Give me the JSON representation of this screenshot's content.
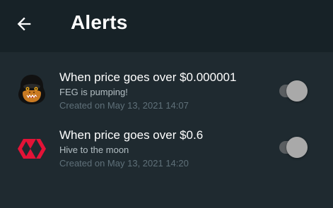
{
  "header": {
    "title": "Alerts",
    "back_icon": "arrow-left-icon"
  },
  "alerts": [
    {
      "heading": "When price goes over $0.000001",
      "note": "FEG is pumping!",
      "created": "Created on May 13, 2021 14:07",
      "icon": "feg-gorilla-logo",
      "enabled": false
    },
    {
      "heading": "When price goes over $0.6",
      "note": "Hive to the moon",
      "created": "Created on May 13, 2021 14:20",
      "icon": "hive-logo",
      "enabled": false
    }
  ],
  "colors": {
    "background": "#1f2a30",
    "appbar": "#172227",
    "note_text": "#b4bfc4",
    "created_text": "#5f7079",
    "hive_red": "#e31337",
    "toggle_track": "#5a5e61",
    "toggle_thumb": "#a9a9a9"
  }
}
